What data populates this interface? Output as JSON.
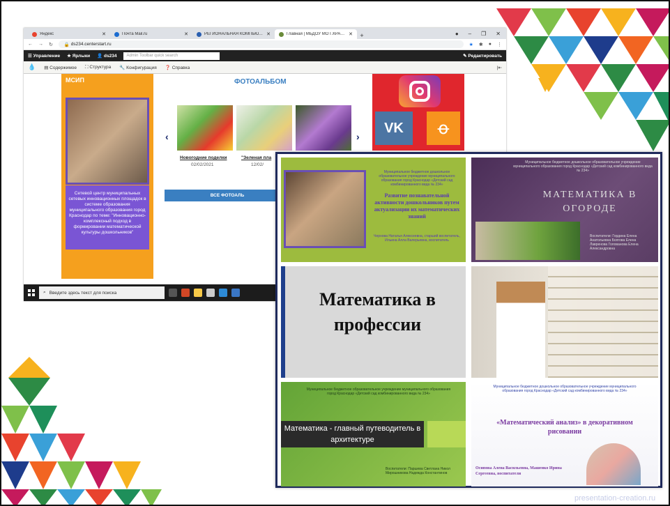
{
  "browser": {
    "tabs": [
      {
        "label": "Яндекс",
        "fav_color": "#e8432e",
        "active": false
      },
      {
        "label": "Почта Mail.ru",
        "fav_color": "#1c6cd0",
        "active": false
      },
      {
        "label": "РЕГИОНАЛЬНАЯ КОМПЬЮТЕР",
        "fav_color": "#2a5fb0",
        "active": false
      },
      {
        "label": "Главная | МБДОУ МО Г.КРАСНО",
        "fav_color": "#6a8b3a",
        "active": true
      }
    ],
    "url": "ds234.centerstart.ru"
  },
  "admin": {
    "manage": "Управление",
    "shortcuts": "Ярлыки",
    "user": "ds234",
    "search_placeholder": "Admin Toolbar quick search",
    "edit": "Редактировать"
  },
  "toolbar": {
    "content": "Содержимое",
    "structure": "Структура",
    "config": "Конфигурация",
    "help": "Справка"
  },
  "page": {
    "left_title": "МСИП",
    "left_caption": "Сетевой центр муниципальных сетевых инновационных площадок в системе образования муниципального образования город Краснодар по теме: \"Инновационно-комплексный подход в формировании математической культуры дошкольников\"",
    "album_title": "ФОТОАЛЬБОМ",
    "photos": [
      {
        "caption": "Новогодние поделки",
        "date": "02/02/2021"
      },
      {
        "caption": "\"Зеленая пла",
        "date": "12/02/"
      }
    ],
    "all_button": "ВСЕ ФОТОАЛЬ"
  },
  "taskbar": {
    "search": "Введите здесь текст для поиска"
  },
  "collage": {
    "c1_head": "Муниципальное бюджетное дошкольное образовательное учреждение муниципального образования город Краснодар «Детский сад комбинированного вида № 234»",
    "c1_title": "Развитие познавательной активности дошкольников путем актуализации их математических знаний",
    "c1_auth": "Чернова Наталья Алексеевна, старший воспитатель, Ильина Алла Валерьевна, воспитатель",
    "c2_head": "Муниципальное бюджетное дошкольное образовательное учреждение муниципального образования город Краснодар «Детский сад комбинированного вида № 234»",
    "c2_title": "МАТЕМАТИКА В ОГОРОДЕ",
    "c2_auth": "Воспитатели: Гордина Елена Анатольевна Болгова Елена Лавренова Голованова Елена Александровна",
    "c3_title": "Математика в профессии",
    "c5_head": "Муниципальное бюджетное образовательное учреждение муниципального образования город Краснодар «Детский сад комбинированного вида № 234»",
    "c5_title": "Математика - главный путеводитель в архитектуре",
    "c5_auth": "Воспитатели: Паршева Светлана Никол Мирошникова Надежда Константинов",
    "c6_head": "Муниципальное бюджетное дошкольное образовательное учреждение муниципального образования город Краснодар «Детский сад комбинированного вида № 234»",
    "c6_title": "«Математический анализ» в декоративном рисовании",
    "c6_auth": "Осипова Алена Васильевна, Машенко Ирина Сергеевна, воспитатели"
  },
  "watermark": "presentation-creation.ru"
}
